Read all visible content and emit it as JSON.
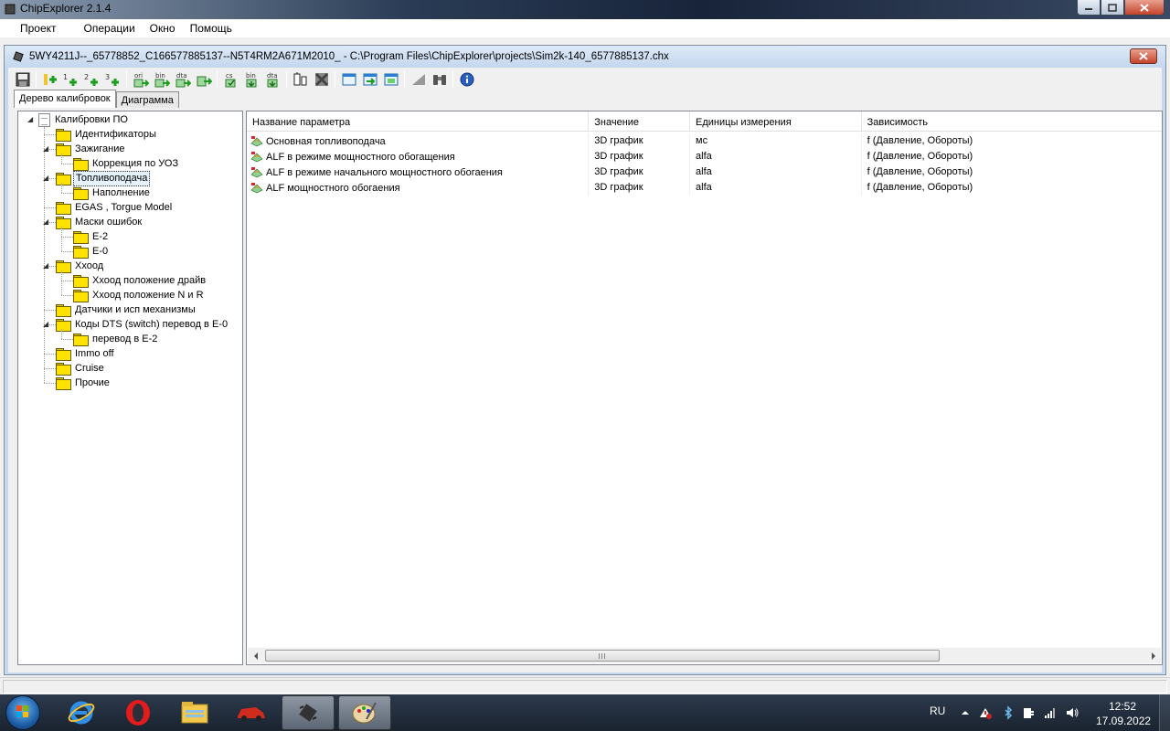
{
  "app": {
    "title": "ChipExplorer 2.1.4"
  },
  "menu": {
    "items": [
      "Проект",
      "Операции",
      "Окно",
      "Помощь"
    ]
  },
  "document": {
    "title": "5WY4211J--_65778852_C166577885137--N5T4RM2A671M2010_ - C:\\Program Files\\ChipExplorer\\projects\\Sim2k-140_6577885137.chx"
  },
  "toolbar": {
    "buttons": [
      {
        "icon": "save-icon"
      },
      {
        "icon": "add-icon"
      },
      {
        "icon": "add-1-icon",
        "label": "1"
      },
      {
        "icon": "add-2-icon",
        "label": "2"
      },
      {
        "icon": "add-3-icon",
        "label": "3"
      },
      {
        "icon": "import-ori-icon",
        "label": "ori"
      },
      {
        "icon": "import-bin-icon",
        "label": "bin"
      },
      {
        "icon": "import-dta-icon",
        "label": "dta"
      },
      {
        "icon": "run-icon"
      },
      {
        "icon": "checksum-icon",
        "label": "cs"
      },
      {
        "icon": "export-bin-icon",
        "label": "bin"
      },
      {
        "icon": "export-dta-icon",
        "label": "dta"
      },
      {
        "icon": "compare-icon"
      },
      {
        "icon": "delete-icon"
      },
      {
        "icon": "window-icon"
      },
      {
        "icon": "window-forward-icon"
      },
      {
        "icon": "window-list-icon"
      },
      {
        "icon": "ramp-icon"
      },
      {
        "icon": "binoculars-icon"
      },
      {
        "icon": "info-icon"
      }
    ]
  },
  "tabs": [
    {
      "label": "Дерево калибровок",
      "active": true
    },
    {
      "label": "Диаграмма",
      "active": false
    }
  ],
  "tree": {
    "root": "Калибровки ПО",
    "items": [
      {
        "label": "Идентификаторы",
        "level": 1,
        "expanded": null
      },
      {
        "label": "Зажигание",
        "level": 1,
        "expanded": true
      },
      {
        "label": "Коррекция по УОЗ",
        "level": 2,
        "expanded": null
      },
      {
        "label": "Топливоподача",
        "level": 1,
        "expanded": true,
        "selected": true
      },
      {
        "label": "Наполнение",
        "level": 2,
        "expanded": null
      },
      {
        "label": "EGAS , Torgue Model",
        "level": 1,
        "expanded": null
      },
      {
        "label": "Маски ошибок",
        "level": 1,
        "expanded": true
      },
      {
        "label": "E-2",
        "level": 2,
        "expanded": null
      },
      {
        "label": "E-0",
        "level": 2,
        "expanded": null
      },
      {
        "label": "Ххоод",
        "level": 1,
        "expanded": true
      },
      {
        "label": "Ххоод положение драйв",
        "level": 2,
        "expanded": null
      },
      {
        "label": "Ххоод положение N и R",
        "level": 2,
        "expanded": null
      },
      {
        "label": "Датчики и исп механизмы",
        "level": 1,
        "expanded": null
      },
      {
        "label": "Коды DTS (switch) перевод в E-0",
        "level": 1,
        "expanded": true
      },
      {
        "label": "перевод в E-2",
        "level": 2,
        "expanded": null
      },
      {
        "label": "Immo off",
        "level": 1,
        "expanded": null
      },
      {
        "label": "Cruise",
        "level": 1,
        "expanded": null
      },
      {
        "label": "Прочие",
        "level": 1,
        "expanded": null
      }
    ]
  },
  "table": {
    "columns": [
      "Название параметра",
      "Значение",
      "Единицы измерения",
      "Зависимость"
    ],
    "rows": [
      {
        "name": "Основная топливоподача",
        "value": "3D график",
        "units": "мс",
        "dependency": "f (Давление, Обороты)"
      },
      {
        "name": "ALF в режиме мощностного обогащения",
        "value": "3D график",
        "units": "alfa",
        "dependency": "f (Давление, Обороты)"
      },
      {
        "name": "ALF в режиме начального мощностного обогаения",
        "value": "3D график",
        "units": "alfa",
        "dependency": "f (Давление, Обороты)"
      },
      {
        "name": "ALF мощностного обогаения",
        "value": "3D график",
        "units": "alfa",
        "dependency": "f (Давление, Обороты)"
      }
    ]
  },
  "taskbar": {
    "apps": [
      {
        "icon": "internet-explorer-icon",
        "active": false
      },
      {
        "icon": "opera-icon",
        "active": false
      },
      {
        "icon": "file-explorer-icon",
        "active": false
      },
      {
        "icon": "car-app-icon",
        "active": false
      },
      {
        "icon": "chipexplorer-icon",
        "active": true
      },
      {
        "icon": "paint-icon",
        "active": true
      }
    ],
    "tray": {
      "language": "RU",
      "time": "12:52",
      "date": "17.09.2022"
    }
  },
  "colors": {
    "selection": "#e5f1fb",
    "folder": "#ffe200",
    "close_button": "#c4442a",
    "taskbar": "#1a2330"
  }
}
